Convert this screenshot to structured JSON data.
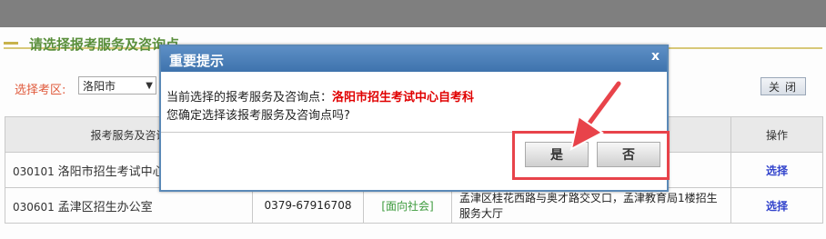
{
  "section": {
    "title": "请选择报考服务及咨询点"
  },
  "filter": {
    "label": "选择考区:",
    "value": "洛阳市"
  },
  "toolbar": {
    "close_label": "关闭"
  },
  "table": {
    "headers": [
      "报考服务及咨询",
      "",
      "",
      "",
      "操作"
    ],
    "rows": [
      {
        "code": "030101",
        "name": "洛阳市招生考试中心自",
        "phone": "",
        "tag": "",
        "address": "",
        "action": "选择"
      },
      {
        "code": "030601",
        "name": "孟津区招生办公室",
        "phone": "0379-67916708",
        "tag": "[面向社会]",
        "address": "孟津区桂花西路与奥才路交叉口，孟津教育局1楼招生服务大厅",
        "action": "选择"
      }
    ]
  },
  "dialog": {
    "title": "重要提示",
    "close": "x",
    "message_prefix": "当前选择的报考服务及咨询点：",
    "message_highlight": "洛阳市招生考试中心自考科",
    "message_confirm": "您确定选择该报考服务及咨询点吗?",
    "yes_label": "是",
    "no_label": "否"
  },
  "colors": {
    "highlight": "#e8434a",
    "dialog_title": "#4a7fb8",
    "selected_text": "#e00000"
  }
}
